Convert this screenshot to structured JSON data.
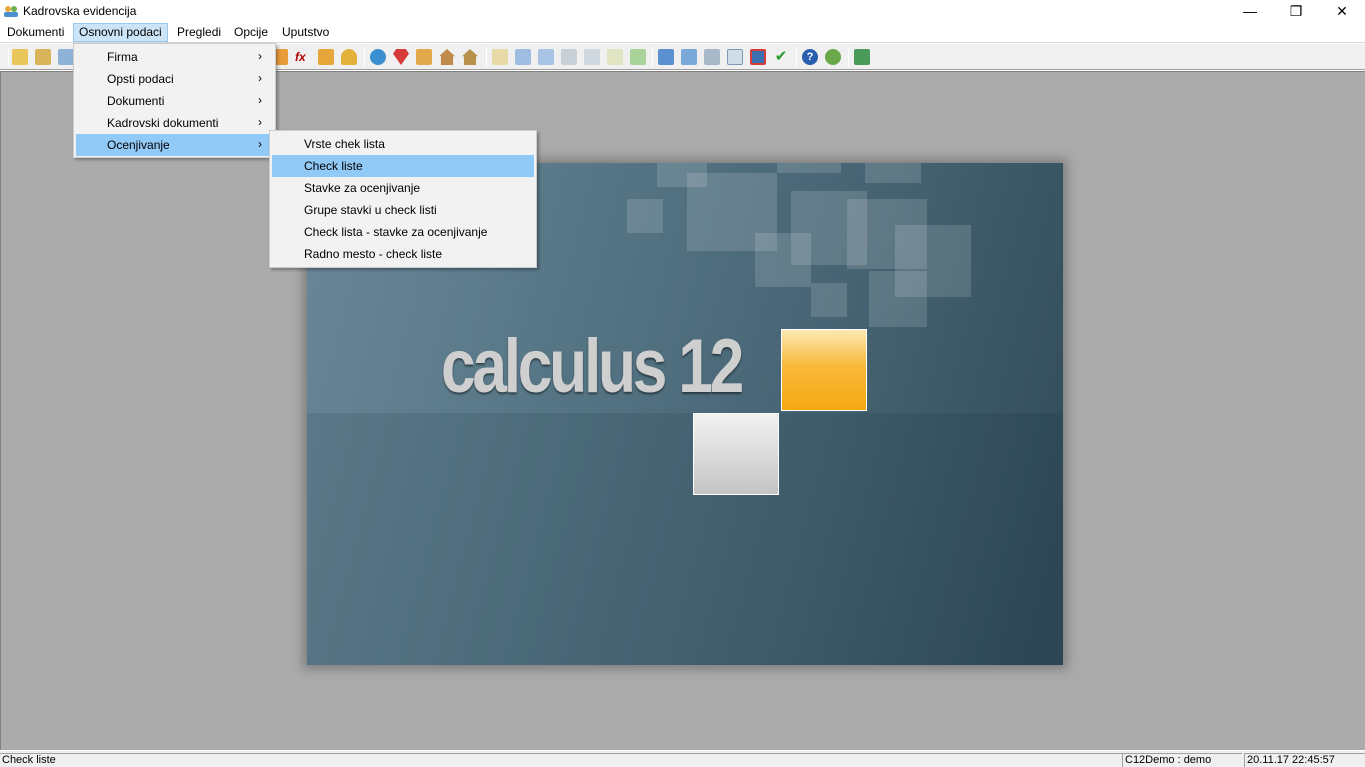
{
  "window": {
    "title": "Kadrovska evidencija",
    "controls": {
      "minimize": "—",
      "maximize": "❐",
      "close": "✕"
    }
  },
  "menubar": {
    "items": [
      "Dokumenti",
      "Osnovni podaci",
      "Pregledi",
      "Opcije",
      "Uputstvo"
    ],
    "active": "Osnovni podaci"
  },
  "toolbar": {
    "icons": [
      "open-folder-icon",
      "document-icon",
      "key-icon",
      "people-icon",
      "fx-icon",
      "worker-icon",
      "person-icon",
      "globe-icon",
      "diamond-icon",
      "edit-icon",
      "house-icon",
      "house-outline-icon",
      "report-icon",
      "report-info-icon",
      "report-cards-icon",
      "tag-icon",
      "tag-outline-icon",
      "list-icon",
      "list-add-icon",
      "layout-icon",
      "table-icon",
      "network-icon",
      "monitor-icon",
      "calendar-icon",
      "checkmark-icon",
      "help-icon",
      "tools-icon",
      "exit-icon"
    ]
  },
  "main_menu": {
    "items": [
      {
        "label": "Firma",
        "has_submenu": true
      },
      {
        "label": "Opsti podaci",
        "has_submenu": true
      },
      {
        "label": "Dokumenti",
        "has_submenu": true
      },
      {
        "label": "Kadrovski dokumenti",
        "has_submenu": true
      },
      {
        "label": "Ocenjivanje",
        "has_submenu": true,
        "highlighted": true
      }
    ]
  },
  "submenu": {
    "items": [
      {
        "label": "Vrste chek lista"
      },
      {
        "label": "Check liste",
        "highlighted": true
      },
      {
        "label": "Stavke za ocenjivanje"
      },
      {
        "label": "Grupe stavki u check listi"
      },
      {
        "label": "Check lista - stavke za ocenjivanje"
      },
      {
        "label": "Radno mesto - check liste"
      }
    ]
  },
  "splash": {
    "logo_text": "calculus 12"
  },
  "statusbar": {
    "message": "Check liste",
    "user": "C12Demo : demo",
    "datetime": "20.11.17 22:45:57"
  },
  "colors": {
    "menu_highlight": "#91c9f7",
    "menubar_active": "#cce4f7",
    "client_background": "#ababab",
    "orange_accent": "#f5a812"
  }
}
